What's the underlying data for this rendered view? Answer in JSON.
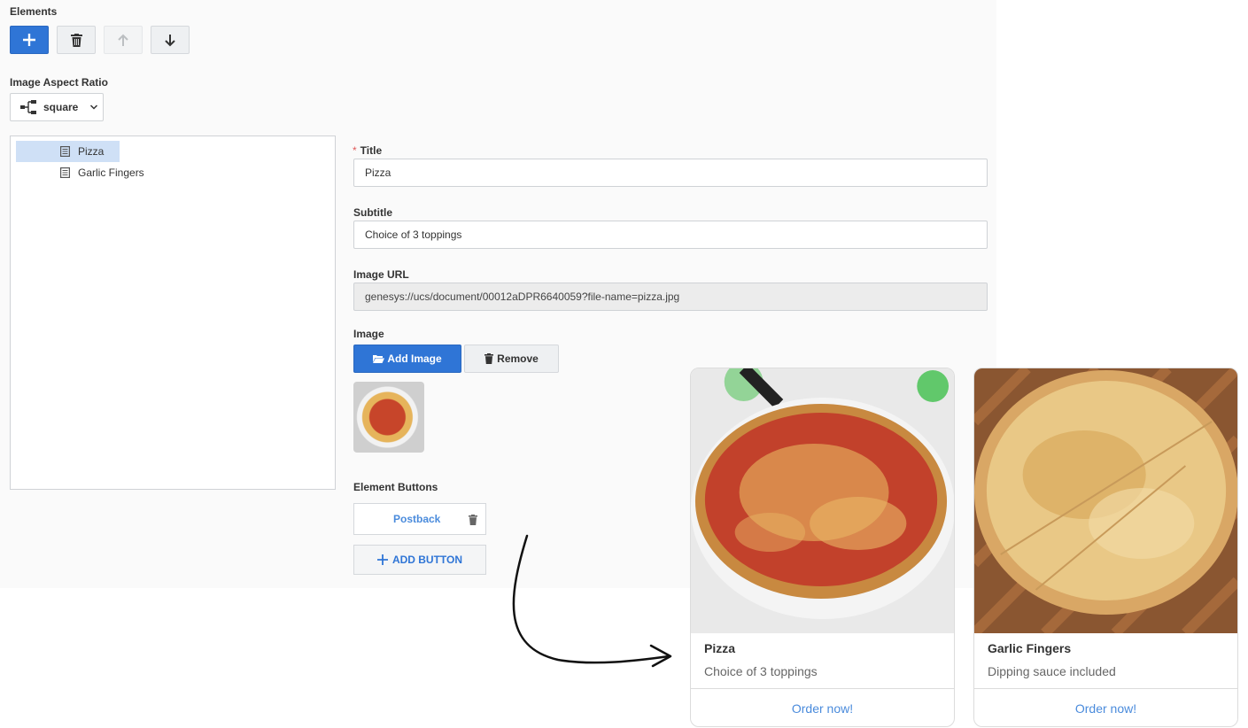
{
  "editor": {
    "elements_label": "Elements",
    "toolbar": {
      "add_icon": "plus-icon",
      "delete_icon": "trash-icon",
      "move_up_icon": "arrow-up-icon",
      "move_down_icon": "arrow-down-icon"
    },
    "aspect_ratio": {
      "label": "Image Aspect Ratio",
      "value": "square"
    },
    "tree": {
      "items": [
        {
          "label": "Pizza",
          "selected": true
        },
        {
          "label": "Garlic Fingers",
          "selected": false
        }
      ]
    },
    "form": {
      "required_marker": "*",
      "title_label": "Title",
      "title_value": "Pizza",
      "subtitle_label": "Subtitle",
      "subtitle_value": "Choice of 3 toppings",
      "image_url_label": "Image URL",
      "image_url_value": "genesys://ucs/document/00012aDPR6640059?file-name=pizza.jpg",
      "image_label": "Image",
      "add_image_label": "Add Image",
      "remove_label": "Remove",
      "element_buttons_label": "Element Buttons",
      "element_buttons": [
        {
          "label": "Postback"
        }
      ],
      "add_button_label": "ADD BUTTON"
    }
  },
  "preview": {
    "cards": [
      {
        "title": "Pizza",
        "subtitle": "Choice of 3 toppings",
        "button": "Order now!"
      },
      {
        "title": "Garlic Fingers",
        "subtitle": "Dipping sauce included",
        "button": "Order now!"
      }
    ]
  },
  "colors": {
    "primary": "#2f75d6",
    "link": "#4a8bdc",
    "selection": "#cfe0f6",
    "required": "#e05a5a"
  }
}
